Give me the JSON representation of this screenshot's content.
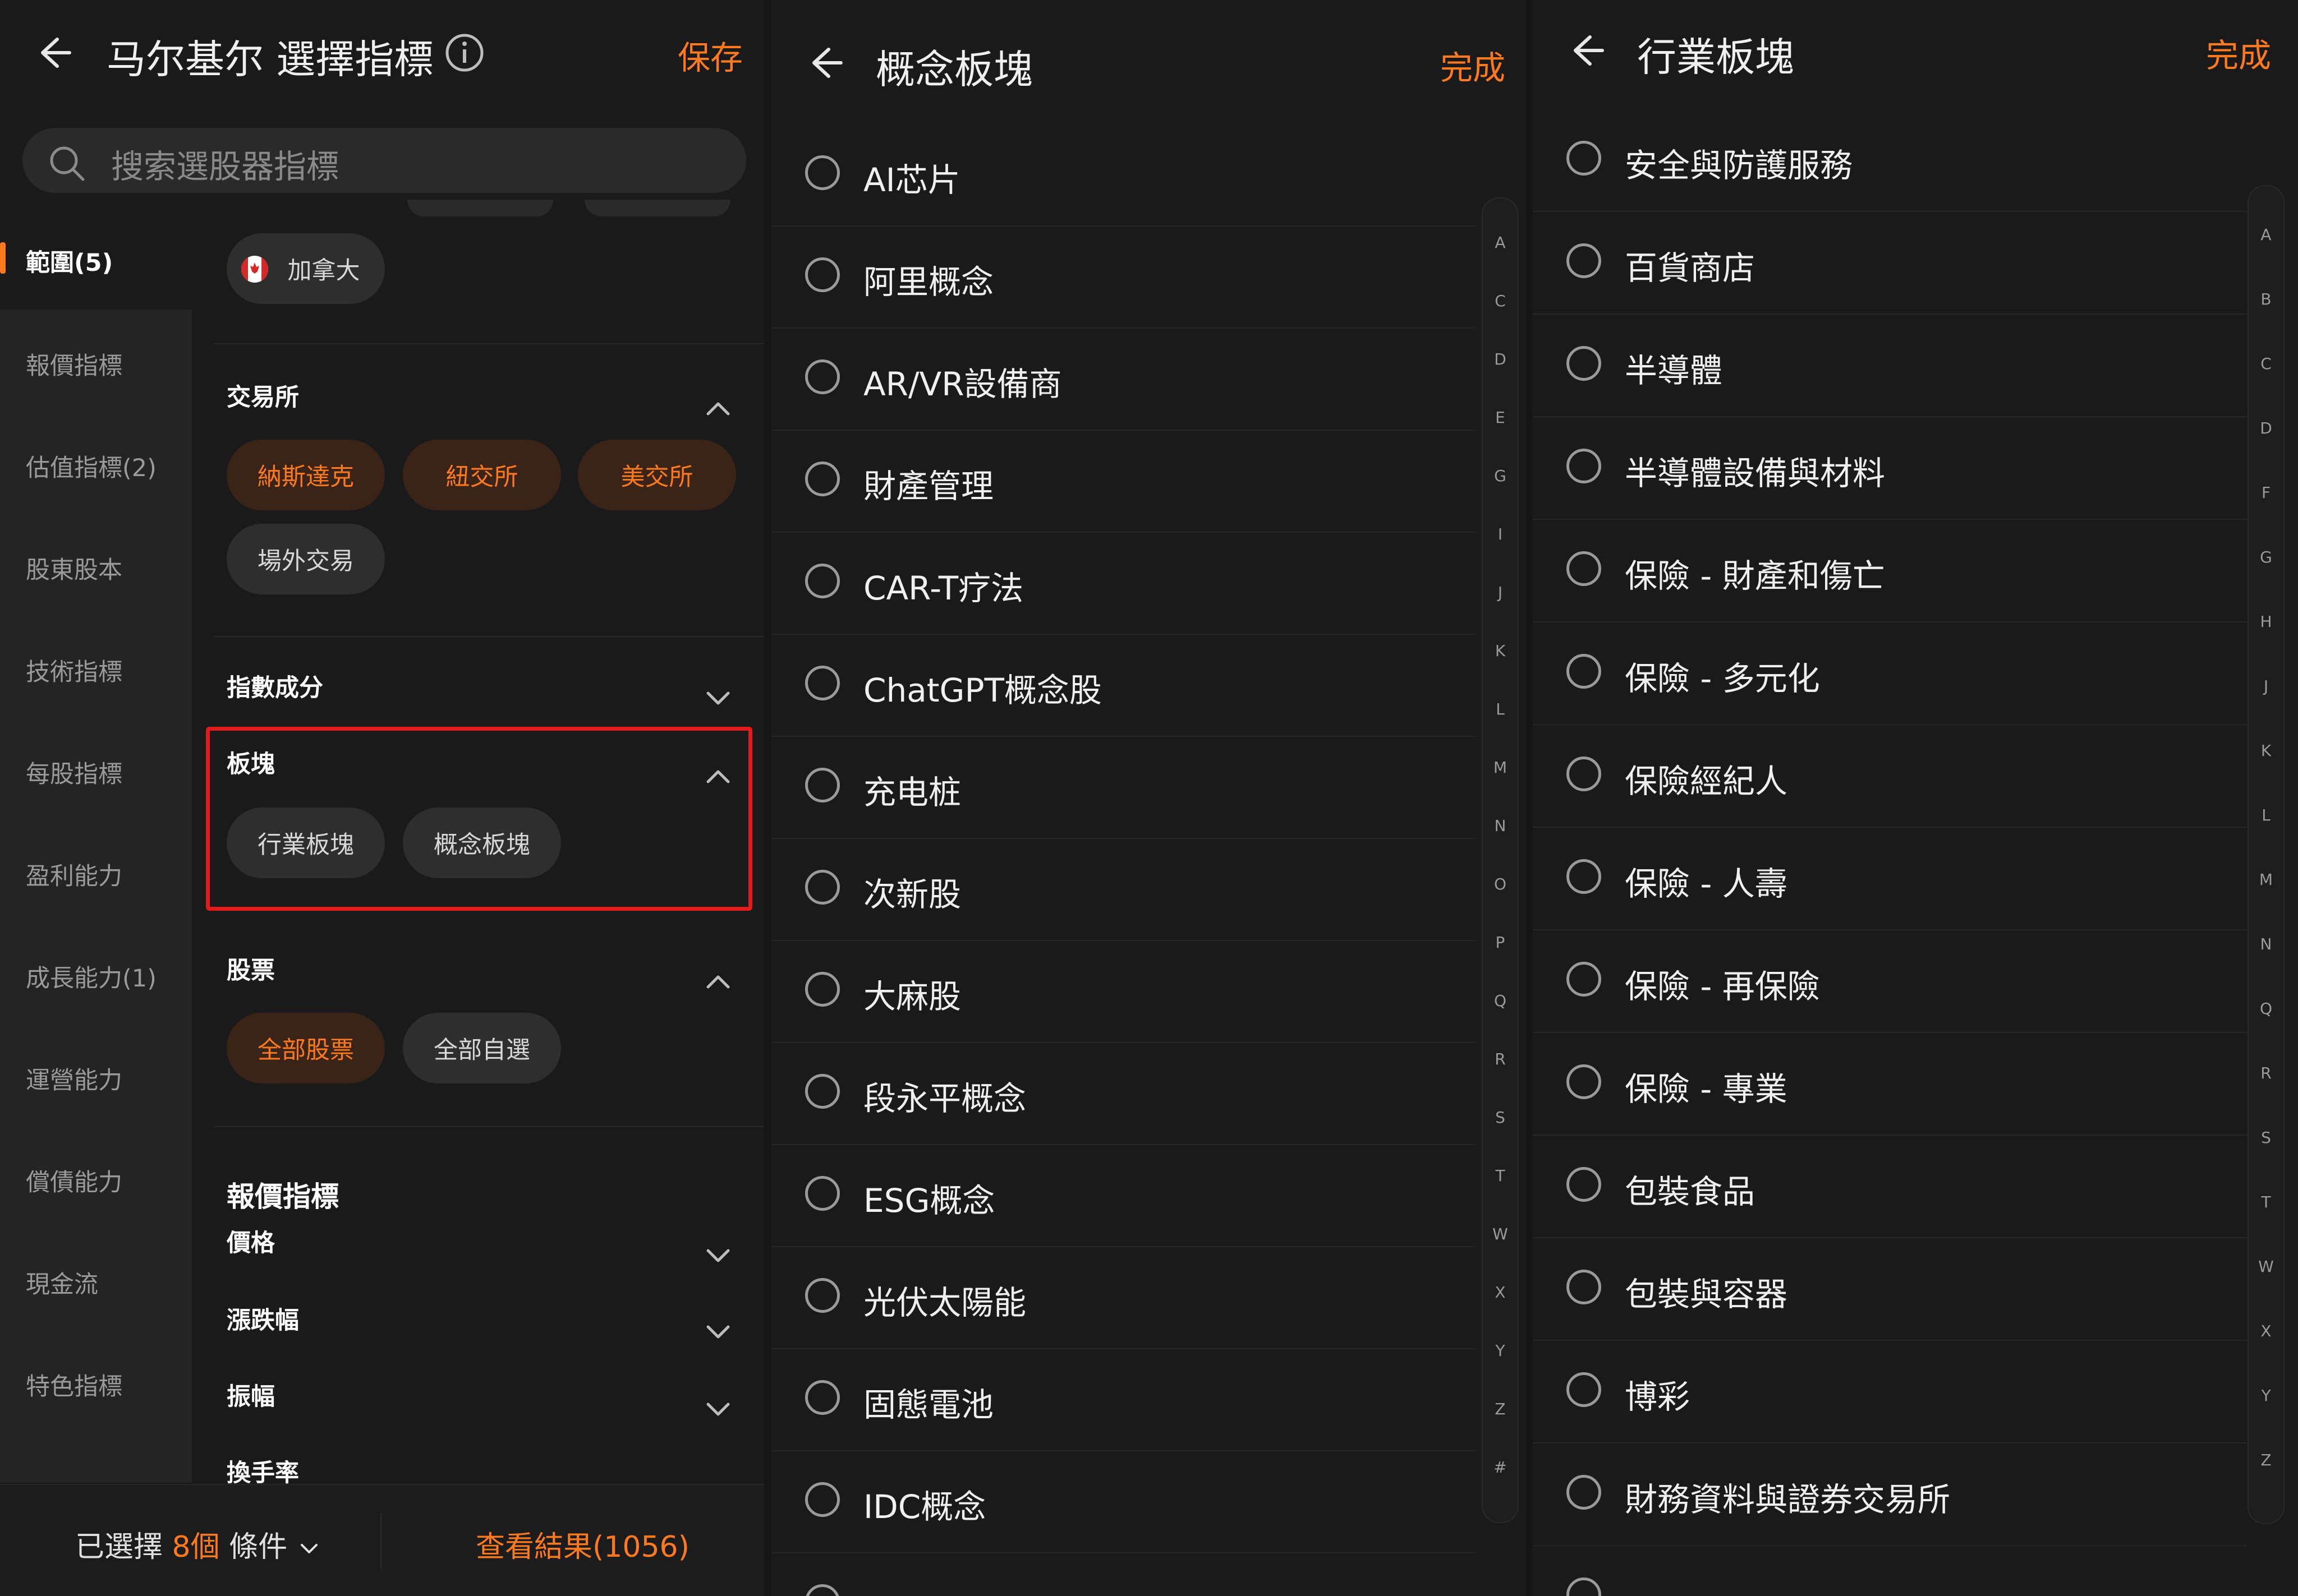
{
  "screen1": {
    "title": "马尔基尔 選擇指標",
    "save": "保存",
    "search_placeholder": "搜索選股器指標",
    "sidebar": [
      "範圍(5)",
      "報價指標",
      "估值指標(2)",
      "股東股本",
      "技術指標",
      "每股指標",
      "盈利能力",
      "成長能力(1)",
      "運營能力",
      "償債能力",
      "現金流",
      "特色指標"
    ],
    "country_chip": "加拿大",
    "exchange": {
      "title": "交易所",
      "chips": [
        "納斯達克",
        "紐交所",
        "美交所",
        "場外交易"
      ]
    },
    "index_title": "指數成分",
    "sector": {
      "title": "板塊",
      "chips": [
        "行業板塊",
        "概念板塊"
      ]
    },
    "stocks": {
      "title": "股票",
      "chips": [
        "全部股票",
        "全部自選"
      ]
    },
    "quote": {
      "title": "報價指標",
      "items": [
        "價格",
        "漲跌幅",
        "振幅",
        "換手率"
      ]
    },
    "footer": {
      "prefix": "已選擇 ",
      "count": "8個",
      "suffix": " 條件",
      "result": "查看結果(1056)"
    }
  },
  "screen2": {
    "title": "概念板塊",
    "done": "完成",
    "items": [
      "AI芯片",
      "阿里概念",
      "AR/VR設備商",
      "財產管理",
      "CAR-T疗法",
      "ChatGPT概念股",
      "充电桩",
      "次新股",
      "大麻股",
      "段永平概念",
      "ESG概念",
      "光伏太陽能",
      "固態電池",
      "IDC概念"
    ],
    "index": [
      "A",
      "C",
      "D",
      "E",
      "G",
      "I",
      "J",
      "K",
      "L",
      "M",
      "N",
      "O",
      "P",
      "Q",
      "R",
      "S",
      "T",
      "W",
      "X",
      "Y",
      "Z",
      "#"
    ]
  },
  "screen3": {
    "title": "行業板塊",
    "done": "完成",
    "items": [
      "安全與防護服務",
      "百貨商店",
      "半導體",
      "半導體設備與材料",
      "保險 - 財產和傷亡",
      "保險 - 多元化",
      "保險經紀人",
      "保險 - 人壽",
      "保險 - 再保險",
      "保險 - 專業",
      "包裝食品",
      "包裝與容器",
      "博彩",
      "財務資料與證券交易所"
    ],
    "index": [
      "A",
      "B",
      "C",
      "D",
      "F",
      "G",
      "H",
      "J",
      "K",
      "L",
      "M",
      "N",
      "Q",
      "R",
      "S",
      "T",
      "W",
      "X",
      "Y",
      "Z"
    ]
  },
  "colors": {
    "accent": "#ff7a1f",
    "highlight": "#e31b1b",
    "background": "#1a1a1a"
  },
  "icons": [
    "back-arrow-icon",
    "info-icon",
    "search-icon",
    "canada-flag-icon",
    "chevron-up-icon",
    "chevron-down-icon",
    "radio-empty-icon"
  ]
}
